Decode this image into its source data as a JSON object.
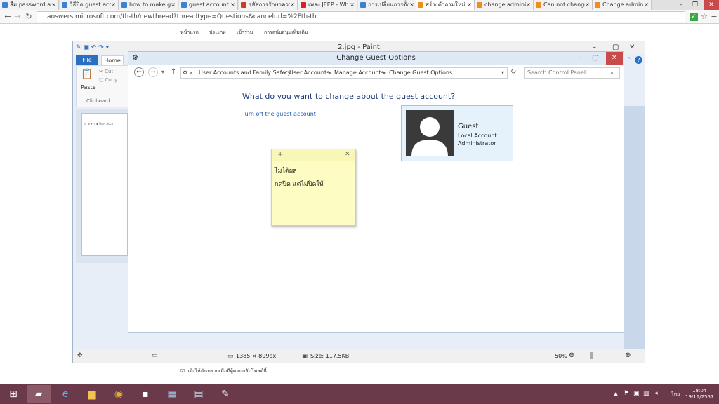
{
  "browser": {
    "tabs": [
      {
        "label": "ลืม password ad",
        "fav": "#3b82d6"
      },
      {
        "label": "วิธีปิด guest acc",
        "fav": "#3b82d6"
      },
      {
        "label": "how to make g",
        "fav": "#3b82d6"
      },
      {
        "label": "guest account",
        "fav": "#3b82d6"
      },
      {
        "label": "รหัสการรักษาความ",
        "fav": "#d03a2a"
      },
      {
        "label": "เพลง JEEP - Wh",
        "fav": "#e02020"
      },
      {
        "label": "การเปลี่ยนการตั้ง",
        "fav": "#3b82d6"
      },
      {
        "label": "สร้างคำถามใหม่",
        "fav": "#f28c1e"
      },
      {
        "label": "change admini",
        "fav": "#f28c1e"
      },
      {
        "label": "Can not change",
        "fav": "#f28c1e"
      },
      {
        "label": "Change admini",
        "fav": "#f28c1e"
      }
    ],
    "url": "answers.microsoft.com/th-th/newthread?threadtype=Questions&cancelurl=%2Fth-th"
  },
  "site_nav": [
    "หน้าแรก",
    "ประเภท",
    "เข้าร่วม",
    "การสนับสนุนเพิ่มเติม"
  ],
  "paint": {
    "title": "2.jpg - Paint",
    "file_tab": "File",
    "home_tab": "Home",
    "paste_label": "Paste",
    "cut_label": "Cut",
    "copy_label": "Copy",
    "clipboard_label": "Clipboard",
    "dimensions": "1385 × 809px",
    "size": "Size: 117.5KB",
    "zoom": "50%"
  },
  "control_panel": {
    "title": "Change Guest Options",
    "breadcrumbs": [
      "User Accounts and Family Safety",
      "User Accounts",
      "Manage Accounts",
      "Change Guest Options"
    ],
    "search_placeholder": "Search Control Panel",
    "heading": "What do you want to change about the guest account?",
    "turn_off_link": "Turn off the guest account",
    "account": {
      "name": "Guest",
      "type": "Local Account",
      "role": "Administrator"
    }
  },
  "sticky_note": {
    "line1": "ไม่ได้ผล",
    "line2": "กดปิด แต่ไม่ปิดให้"
  },
  "notify_checkbox": "แจ้งให้ฉันทราบเมื่อมีผู้ตอบกลับโพสต์นี้",
  "taskbar": {
    "lang": "ไทย",
    "time": "18:04",
    "date": "19/11/2557"
  },
  "colors": {
    "taskbar": "#6b3a4a",
    "link": "#1a56a8",
    "heading": "#1e3a78",
    "sticky": "#fdfdc3"
  }
}
